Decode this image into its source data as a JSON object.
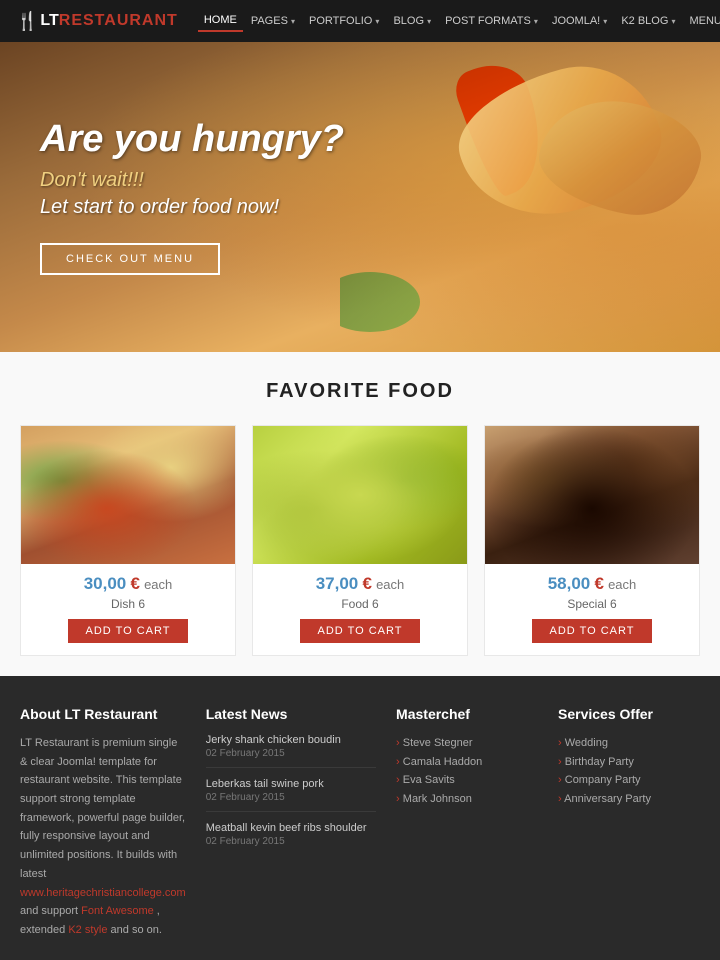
{
  "header": {
    "logo_fork": "🍴",
    "logo_lt": "LT",
    "logo_restaurant": "RESTAURANT",
    "nav": [
      {
        "label": "HOME",
        "active": true
      },
      {
        "label": "PAGES",
        "has_dropdown": true
      },
      {
        "label": "PORTFOLIO",
        "has_dropdown": true
      },
      {
        "label": "BLOG",
        "has_dropdown": true
      },
      {
        "label": "POST FORMATS",
        "has_dropdown": true
      },
      {
        "label": "JOOMLA!",
        "has_dropdown": true
      },
      {
        "label": "K2 BLOG",
        "has_dropdown": true
      },
      {
        "label": "MENU",
        "has_dropdown": true
      }
    ]
  },
  "hero": {
    "headline": "Are you hungry?",
    "sub1": "Don't wait!!!",
    "sub2": "Let start to order food now!",
    "cta_label": "CHECK OUT MENU"
  },
  "favorite": {
    "section_title": "FAVORITE FOOD",
    "items": [
      {
        "price_amount": "30,00",
        "price_currency": "€",
        "price_each": "each",
        "name": "Dish 6",
        "add_cart": "ADD TO CART"
      },
      {
        "price_amount": "37,00",
        "price_currency": "€",
        "price_each": "each",
        "name": "Food 6",
        "add_cart": "ADD TO CART"
      },
      {
        "price_amount": "58,00",
        "price_currency": "€",
        "price_each": "each",
        "name": "Special 6",
        "add_cart": "ADD TO CART"
      }
    ]
  },
  "footer": {
    "about": {
      "title": "About LT Restaurant",
      "text": "LT Restaurant is premium single & clear Joomla! template for restaurant website. This template support strong template framework, powerful page builder, fully responsive layout and unlimited positions. It builds with latest",
      "website": "www.heritagechristiancollege.com",
      "text2": "and support",
      "font_awesome": "Font Awesome",
      "text3": ", extended",
      "k2_style": "K2 style",
      "text4": "and so on."
    },
    "latest_news": {
      "title": "Latest News",
      "items": [
        {
          "title": "Jerky shank chicken boudin",
          "date": "02 February 2015"
        },
        {
          "title": "Leberkas tail swine pork",
          "date": "02 February 2015"
        },
        {
          "title": "Meatball kevin beef ribs shoulder",
          "date": "02 February 2015"
        }
      ]
    },
    "masterchef": {
      "title": "Masterchef",
      "items": [
        "Steve Stegner",
        "Camala Haddon",
        "Eva Savits",
        "Mark Johnson"
      ]
    },
    "services": {
      "title": "Services Offer",
      "items": [
        "Wedding",
        "Birthday Party",
        "Company Party",
        "Anniversary Party"
      ]
    }
  }
}
